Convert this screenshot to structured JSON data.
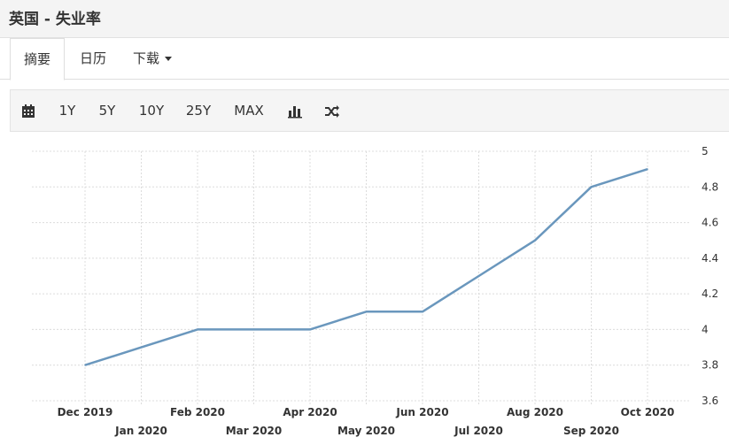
{
  "page": {
    "title": "英国 - 失业率"
  },
  "tabs": [
    {
      "label": "摘要",
      "active": true
    },
    {
      "label": "日历",
      "active": false
    },
    {
      "label": "下载",
      "active": false,
      "dropdown": true
    }
  ],
  "toolbar": {
    "calendar_icon": "calendar-icon",
    "ranges": [
      "1Y",
      "5Y",
      "10Y",
      "25Y",
      "MAX"
    ],
    "bar_chart_icon": "bar-chart-icon",
    "compare_icon": "shuffle-icon"
  },
  "chart_data": {
    "type": "line",
    "x": [
      "Dec 2019",
      "Jan 2020",
      "Feb 2020",
      "Mar 2020",
      "Apr 2020",
      "May 2020",
      "Jun 2020",
      "Jul 2020",
      "Aug 2020",
      "Sep 2020",
      "Oct 2020"
    ],
    "series": [
      {
        "values": [
          3.8,
          3.9,
          4.0,
          4.0,
          4.0,
          4.1,
          4.1,
          4.3,
          4.5,
          4.8,
          4.9
        ],
        "color": "#6a97bd"
      }
    ],
    "yticks": [
      "5",
      "4.8",
      "4.6",
      "4.4",
      "4.2",
      "4",
      "3.8",
      "3.6"
    ],
    "ylim": [
      3.6,
      5.0
    ],
    "y_axis_side": "right",
    "grid": true,
    "grid_color": "#dcdcdc"
  }
}
